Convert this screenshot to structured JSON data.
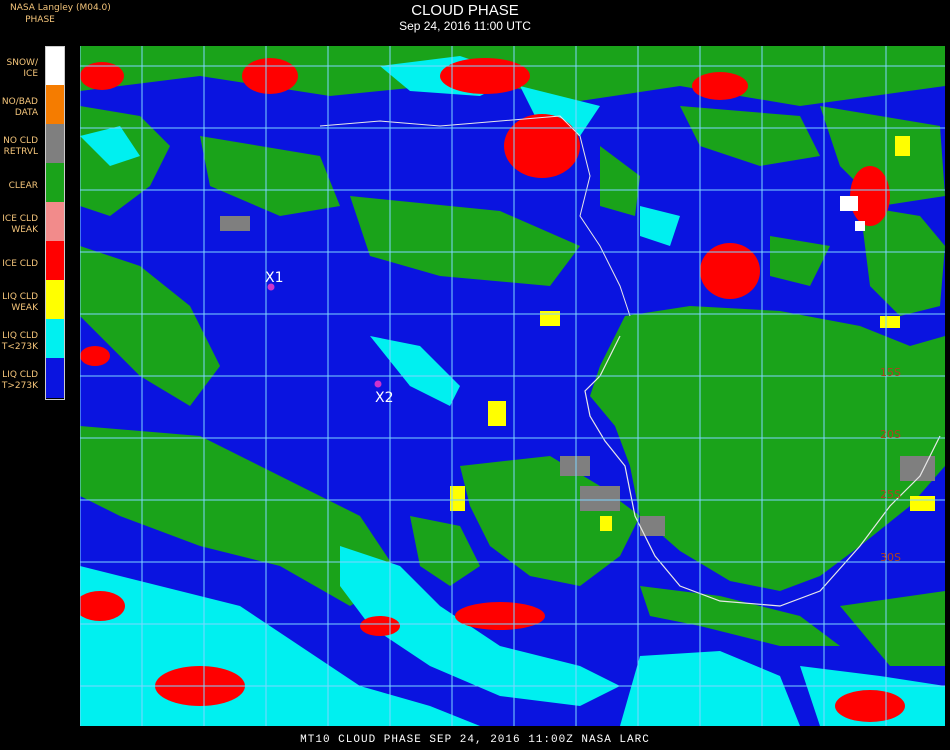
{
  "header": {
    "product": "NASA Langley (M04.0)",
    "legend_title": "PHASE",
    "title": "CLOUD PHASE",
    "datetime": "Sep 24, 2016 11:00 UTC"
  },
  "legend": {
    "items": [
      {
        "label": "SNOW/\nICE",
        "color": "#ffffff"
      },
      {
        "label": "NO/BAD\nDATA",
        "color": "#f57c00"
      },
      {
        "label": "NO CLD\nRETRVL",
        "color": "#7f7f7f"
      },
      {
        "label": "CLEAR",
        "color": "#1aa31a"
      },
      {
        "label": "ICE CLD\nWEAK",
        "color": "#f28b8b"
      },
      {
        "label": "ICE CLD",
        "color": "#ff0000"
      },
      {
        "label": "LIQ CLD\nWEAK",
        "color": "#ffff00"
      },
      {
        "label": "LIQ CLD\nT<273K",
        "color": "#00f0f0"
      },
      {
        "label": "LIQ CLD\nT>273K",
        "color": "#0a14e0"
      }
    ]
  },
  "map": {
    "grid_color": "#7fd6ff",
    "markers": [
      {
        "label": "X1",
        "color": "#cc33cc"
      },
      {
        "label": "X2",
        "color": "#cc33cc"
      }
    ],
    "latitude_labels": [
      "15S",
      "20S",
      "25S",
      "30S"
    ],
    "latitude_label_color": "#b04020"
  },
  "footer": {
    "caption": "MT10   CLOUD PHASE   SEP 24, 2016 11:00Z   NASA LARC"
  }
}
